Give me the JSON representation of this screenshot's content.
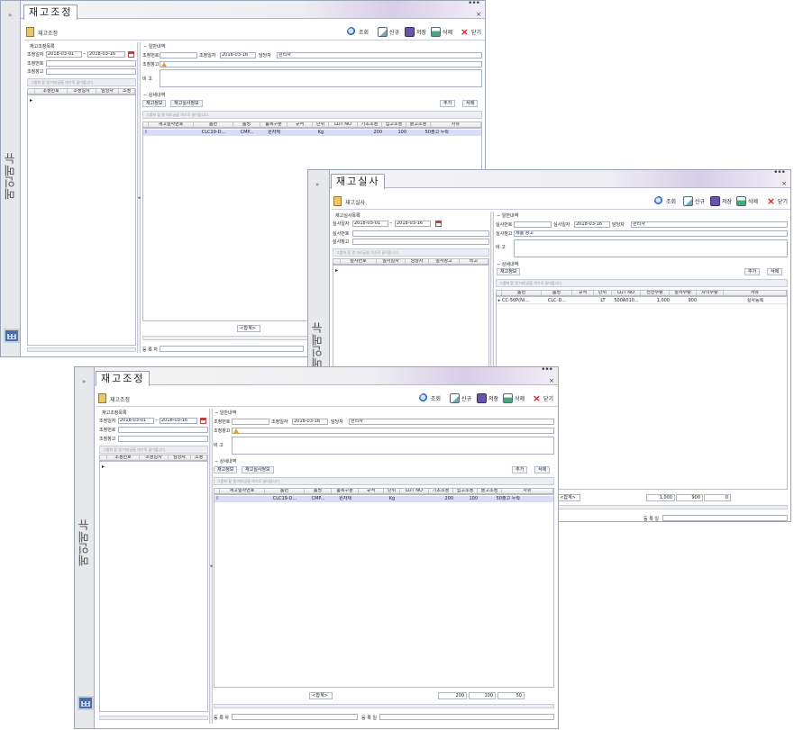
{
  "sidebar": {
    "chevron": "»",
    "menu_label": "메인메뉴",
    "calendar_icon": "calendar-icon"
  },
  "common": {
    "close_x": "×",
    "dots": "•••",
    "btn_search": "조회",
    "btn_new": "신규",
    "btn_save": "저장",
    "btn_delete": "삭제",
    "btn_close": "닫기",
    "collapse_marker": "−",
    "group_hint": "그룹화 할 열 머리글을 여기로 끌어옵니다.",
    "add": "추가",
    "delete": "삭제",
    "row_marker": "▸",
    "footer_sum": "<합계>",
    "dropdown": "▾",
    "ellipsis": "...",
    "tilde": "~",
    "splitter": "◂"
  },
  "window1": {
    "tab_title": "재고조정",
    "toolbar_title": "재고조정",
    "list_panel_title": "재고조정목록",
    "labels": {
      "adj_date": "조정일자",
      "adj_no": "조정번호",
      "adj_wh": "조정창고",
      "general": "일반내역",
      "detail": "상세내역",
      "adj_date2": "조정일자",
      "manager": "담당자",
      "remarks": "비   고",
      "registrant": "등 록 자",
      "reg_date": "등 록 일"
    },
    "date_from": "2018-03-01",
    "date_to": "2018-03-16",
    "adj_date_value": "2018-03-16",
    "manager_value": "관리자",
    "list_columns": [
      "조정번호",
      "조정일자",
      "담당자",
      "조정"
    ],
    "detail_buttons": [
      "재고정보",
      "재고실사정보"
    ],
    "detail_columns": [
      "재고실사번호",
      "품번",
      "품명",
      "품목구분",
      "규격",
      "단위",
      "LOT NO",
      "기초조정",
      "입고조정",
      "출고조정",
      "사유"
    ],
    "detail_row": [
      "",
      "CLC19-D...",
      "CMP...",
      "원자재",
      "",
      "Kg",
      "",
      "200",
      "100",
      "50",
      "출고 누락"
    ],
    "totals": [
      "200",
      "100",
      "50"
    ]
  },
  "window2": {
    "tab_title": "재고실사",
    "toolbar_title": "재고실사",
    "list_panel_title": "재고실사목록",
    "labels": {
      "date": "실사일자",
      "no": "실사번호",
      "wh": "실사창고",
      "general": "일반내역",
      "detail": "상세내역",
      "date2": "실사일자",
      "manager": "담당자",
      "remarks": "비   고",
      "reg_date": "등 록 일"
    },
    "date_from": "2018-03-01",
    "date_to": "2018-03-16",
    "date_value": "2018-03-16",
    "manager_value": "관리자",
    "wh_value": "제품 창고",
    "list_columns": [
      "실사번호",
      "실사일자",
      "담당자",
      "실사창고",
      "비고"
    ],
    "detail_button": "재고정보",
    "detail_columns": [
      "품번",
      "품명",
      "규격",
      "단위",
      "LOT NO",
      "전산수량",
      "실사수량",
      "차이수량",
      "사유"
    ],
    "detail_row": [
      "CC-50P(Ni...",
      "CLC-D...",
      "",
      "LT",
      "500A010...",
      "1,000",
      "900",
      "",
      "실사등록"
    ],
    "totals": [
      "1,000",
      "900",
      "0"
    ]
  }
}
